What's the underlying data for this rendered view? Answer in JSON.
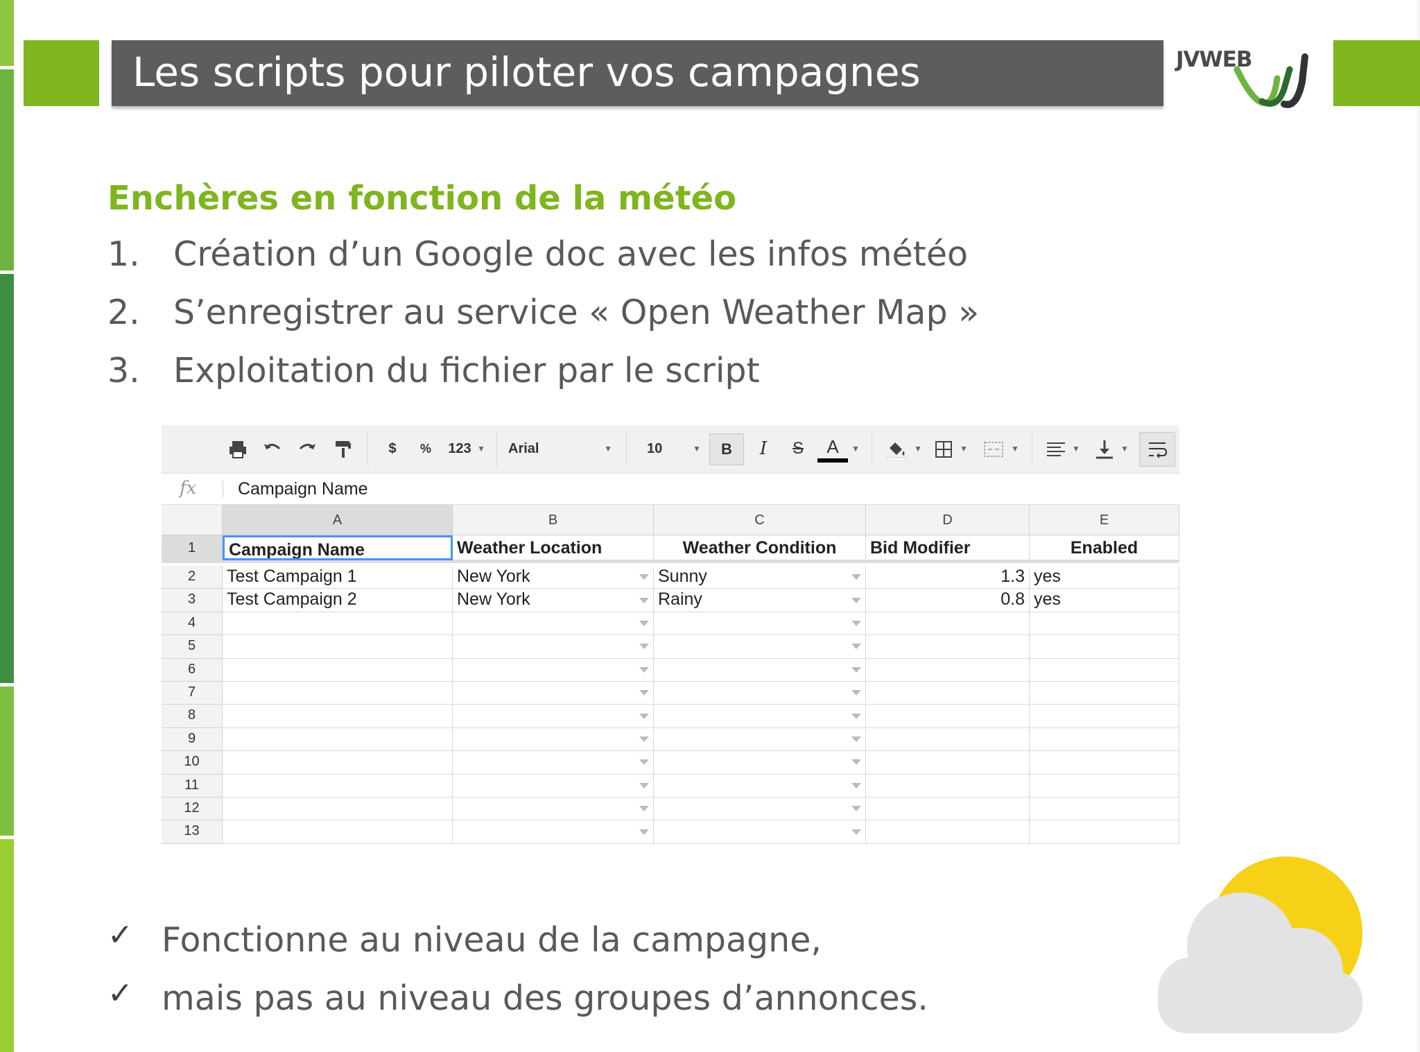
{
  "header": {
    "title": "Les scripts pour piloter vos campagnes",
    "logo_text": "JVWEB"
  },
  "content": {
    "subtitle": "Enchères en fonction de la météo",
    "steps": [
      {
        "num": "1.",
        "text": "Création d’un Google doc avec les infos météo"
      },
      {
        "num": "2.",
        "text": "S’enregistrer au service « Open Weather Map »"
      },
      {
        "num": "3.",
        "text": "Exploitation du fichier par le script"
      }
    ],
    "checks": [
      "Fonctionne au niveau de la campagne,",
      "mais pas au niveau des groupes d’annonces."
    ]
  },
  "spreadsheet": {
    "toolbar": {
      "currency": "$",
      "percent": "%",
      "number_format": "123",
      "font": "Arial",
      "font_size": "10",
      "bold": "B",
      "italic": "I",
      "strike": "S",
      "text_color": "A"
    },
    "formula_bar": {
      "label": "fx",
      "value": "Campaign Name"
    },
    "columns": [
      "A",
      "B",
      "C",
      "D",
      "E"
    ],
    "rows": [
      {
        "num": "1",
        "cells": [
          "Campaign Name",
          "Weather Location",
          "Weather Condition",
          "Bid Modifier",
          "Enabled"
        ]
      },
      {
        "num": "2",
        "cells": [
          "Test Campaign 1",
          "New York",
          "Sunny",
          "1.3",
          "yes"
        ]
      },
      {
        "num": "3",
        "cells": [
          "Test Campaign 2",
          "New York",
          "Rainy",
          "0.8",
          "yes"
        ]
      },
      {
        "num": "4",
        "cells": [
          "",
          "",
          "",
          "",
          ""
        ]
      },
      {
        "num": "5",
        "cells": [
          "",
          "",
          "",
          "",
          ""
        ]
      },
      {
        "num": "6",
        "cells": [
          "",
          "",
          "",
          "",
          ""
        ]
      },
      {
        "num": "7",
        "cells": [
          "",
          "",
          "",
          "",
          ""
        ]
      },
      {
        "num": "8",
        "cells": [
          "",
          "",
          "",
          "",
          ""
        ]
      },
      {
        "num": "9",
        "cells": [
          "",
          "",
          "",
          "",
          ""
        ]
      },
      {
        "num": "10",
        "cells": [
          "",
          "",
          "",
          "",
          ""
        ]
      },
      {
        "num": "11",
        "cells": [
          "",
          "",
          "",
          "",
          ""
        ]
      },
      {
        "num": "12",
        "cells": [
          "",
          "",
          "",
          "",
          ""
        ]
      },
      {
        "num": "13",
        "cells": [
          "",
          "",
          "",
          "",
          ""
        ]
      }
    ]
  },
  "colors": {
    "accent_green": "#7fb51e",
    "header_gray": "#5d5d5d",
    "sun_yellow": "#f7d117",
    "cloud_gray": "#e3e3e3"
  }
}
